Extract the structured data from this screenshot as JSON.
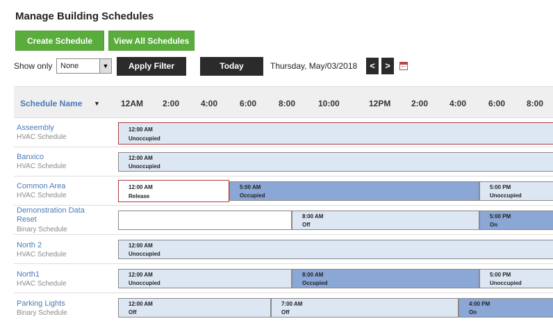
{
  "page": {
    "title": "Manage Building Schedules"
  },
  "toolbar": {
    "create_label": "Create Schedule",
    "view_all_label": "View All Schedules",
    "show_only_label": "Show only",
    "show_only_value": "None",
    "apply_label": "Apply Filter",
    "today_label": "Today",
    "date": "Thursday, May/03/2018",
    "prev_label": "<",
    "next_label": ">",
    "calendar_icon": "calendar-icon"
  },
  "grid": {
    "name_header": "Schedule Name",
    "sort_icon": "▼",
    "ticks": [
      "12AM",
      "2:00",
      "4:00",
      "6:00",
      "8:00",
      "10:00",
      "12PM",
      "2:00",
      "4:00",
      "6:00",
      "8:00"
    ]
  },
  "rows": [
    {
      "name": "Asseembly",
      "type": "HVAC Schedule",
      "segments": [
        {
          "time": "12:00 AM",
          "state": "Unoccupied"
        }
      ]
    },
    {
      "name": "Banxico",
      "type": "HVAC Schedule",
      "segments": [
        {
          "time": "12:00 AM",
          "state": "Unoccupied"
        }
      ]
    },
    {
      "name": "Common Area",
      "type": "HVAC Schedule",
      "segments": [
        {
          "time": "12:00 AM",
          "state": "Release"
        },
        {
          "time": "5:00 AM",
          "state": "Occupied"
        },
        {
          "time": "5:00 PM",
          "state": "Unoccupied"
        }
      ]
    },
    {
      "name": "Demonstration Data Reset",
      "name_line1": "Demonstration Data",
      "name_line2": "Reset",
      "type": "Binary Schedule",
      "segments": [
        {
          "time": "8:00 AM",
          "state": "Off"
        },
        {
          "time": "5:00 PM",
          "state": "On"
        }
      ]
    },
    {
      "name": "North 2",
      "type": "HVAC Schedule",
      "segments": [
        {
          "time": "12:00 AM",
          "state": "Unoccupied"
        }
      ]
    },
    {
      "name": "North1",
      "type": "HVAC Schedule",
      "segments": [
        {
          "time": "12:00 AM",
          "state": "Unoccupied"
        },
        {
          "time": "8:00 AM",
          "state": "Occupied"
        },
        {
          "time": "5:00 PM",
          "state": "Unoccupied"
        }
      ]
    },
    {
      "name": "Parking Lights",
      "type": "Binary Schedule",
      "segments": [
        {
          "time": "12:00 AM",
          "state": "Off"
        },
        {
          "time": "7:00 AM",
          "state": "Off"
        },
        {
          "time": "4:00 PM",
          "state": "On"
        }
      ]
    }
  ]
}
